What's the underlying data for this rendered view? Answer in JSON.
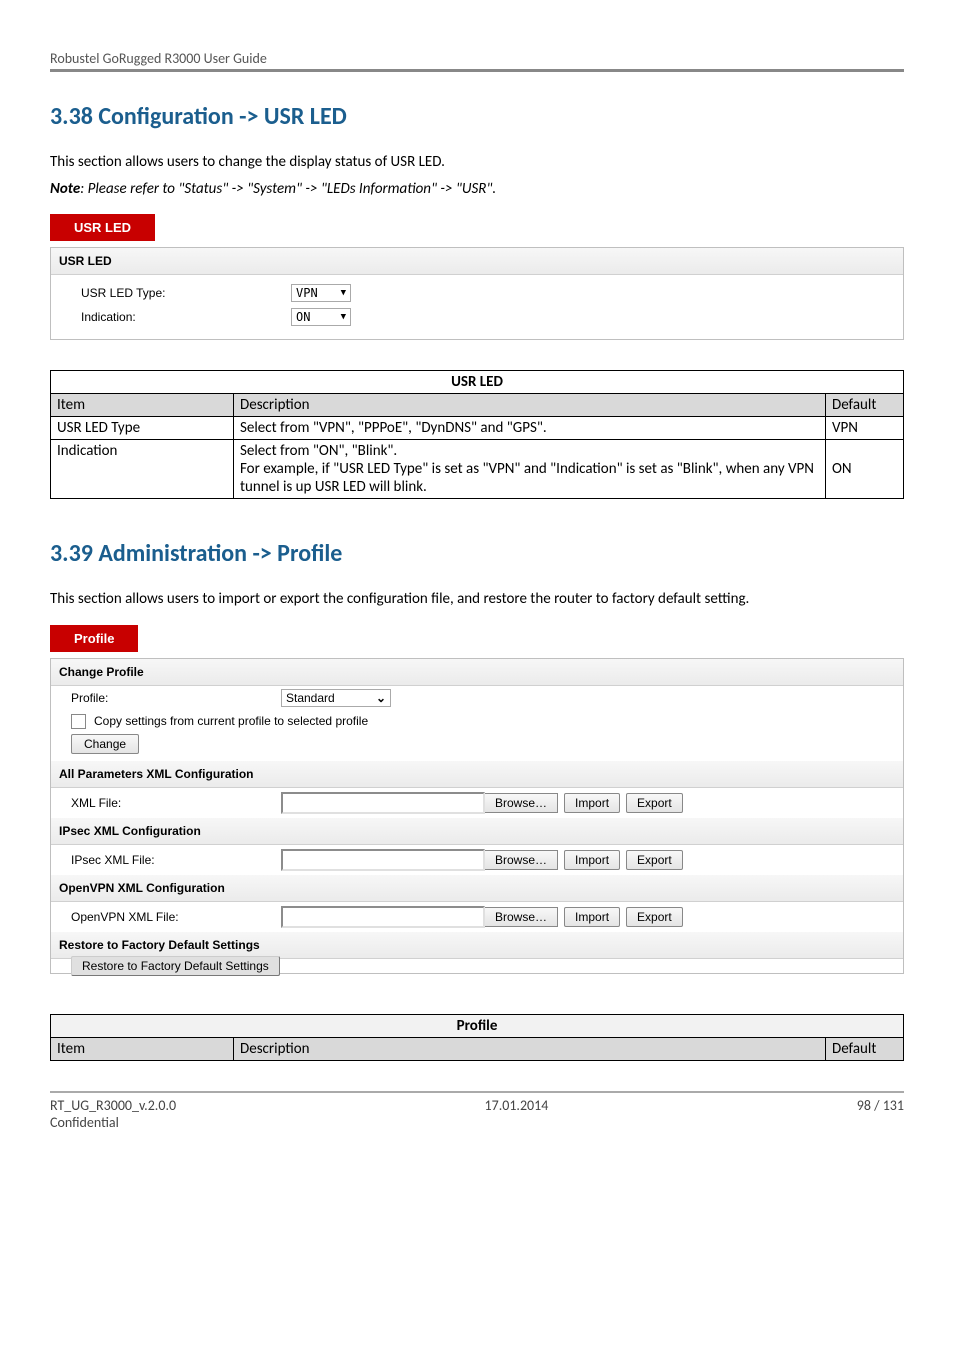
{
  "header": {
    "guide": "Robustel GoRugged R3000 User Guide"
  },
  "section38": {
    "heading": "3.38  Configuration -> USR LED",
    "intro": "This section allows users to change the display status of USR LED.",
    "note_label": "Note",
    "note_text": ": Please refer to \"Status\" -> \"System\" -> \"LEDs Information\" -> \"USR\".",
    "tab": "USR LED",
    "panel_header": "USR LED",
    "rows": {
      "type_label": "USR LED Type:",
      "type_value": "VPN",
      "indication_label": "Indication:",
      "indication_value": "ON"
    },
    "table": {
      "title": "USR LED",
      "headers": {
        "item": "Item",
        "desc": "Description",
        "def": "Default"
      },
      "r1": {
        "item": "USR LED Type",
        "desc": "Select from \"VPN\", \"PPPoE\", \"DynDNS\" and \"GPS\".",
        "def": "VPN"
      },
      "r2": {
        "item": "Indication",
        "desc": "Select from \"ON\", \"Blink\".\nFor example, if \"USR LED Type\" is set as \"VPN\" and \"Indication\" is set as \"Blink\", when any VPN tunnel is up USR LED will blink.",
        "def": "ON"
      }
    }
  },
  "section39": {
    "heading": "3.39  Administration -> Profile",
    "intro": "This section allows users to import or export the configuration file, and restore the router to factory default setting.",
    "tab": "Profile",
    "panel": {
      "change_profile": "Change Profile",
      "profile_label": "Profile:",
      "profile_value": "Standard",
      "copy_label": "Copy settings from current profile to selected profile",
      "change_btn": "Change",
      "all_params": "All Parameters XML Configuration",
      "xml_file": "XML File:",
      "ipsec_conf": "IPsec XML Configuration",
      "ipsec_file": "IPsec XML File:",
      "openvpn_conf": "OpenVPN XML Configuration",
      "openvpn_file": "OpenVPN XML File:",
      "restore_header": "Restore to Factory Default Settings",
      "restore_btn": "Restore to Factory Default Settings",
      "browse": "Browse…",
      "import": "Import",
      "export": "Export"
    },
    "table": {
      "title": "Profile",
      "headers": {
        "item": "Item",
        "desc": "Description",
        "def": "Default"
      }
    }
  },
  "footer": {
    "left1": "RT_UG_R3000_v.2.0.0",
    "left2": "Confidential",
    "center": "17.01.2014",
    "right": "98 / 131"
  }
}
